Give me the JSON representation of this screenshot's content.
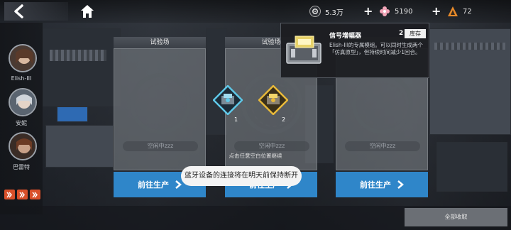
{
  "topbar": {
    "resources": [
      {
        "icon": "gear-core-icon",
        "value": "5.3万"
      },
      {
        "icon": "pink-flower-icon",
        "value": "5190"
      },
      {
        "icon": "orange-triangle-icon",
        "value": "72"
      }
    ]
  },
  "characters": [
    {
      "name": "Elish-III"
    },
    {
      "name": "安妮"
    },
    {
      "name": "巴雷特"
    }
  ],
  "cards": [
    {
      "title": "试验场",
      "idle_label": "空闲中zzz",
      "action_label": "前往生产"
    },
    {
      "title": "试验场",
      "idle_label": "空闲中zzz",
      "action_label": "前往生产"
    },
    {
      "title": "",
      "idle_label": "空闲中zzz",
      "action_label": "前往生产"
    }
  ],
  "items": [
    {
      "count": "1",
      "color": "#5fc8e8"
    },
    {
      "count": "2",
      "color": "#e8b93a"
    }
  ],
  "hint": "点击任意空白位置继续",
  "tooltip": {
    "name": "信号增幅器",
    "quantity": "2",
    "stock_label": "库存",
    "description": "Elish-III的专属模组。可以同时生成两个「仿真原型」，但持续时间减少1回合。"
  },
  "toast": "蓝牙设备的连接将在明天前保持断开",
  "collect_all_label": "全部收取",
  "colors": {
    "accent_blue": "#2f86c9",
    "rail_orange": "#d9502a"
  }
}
